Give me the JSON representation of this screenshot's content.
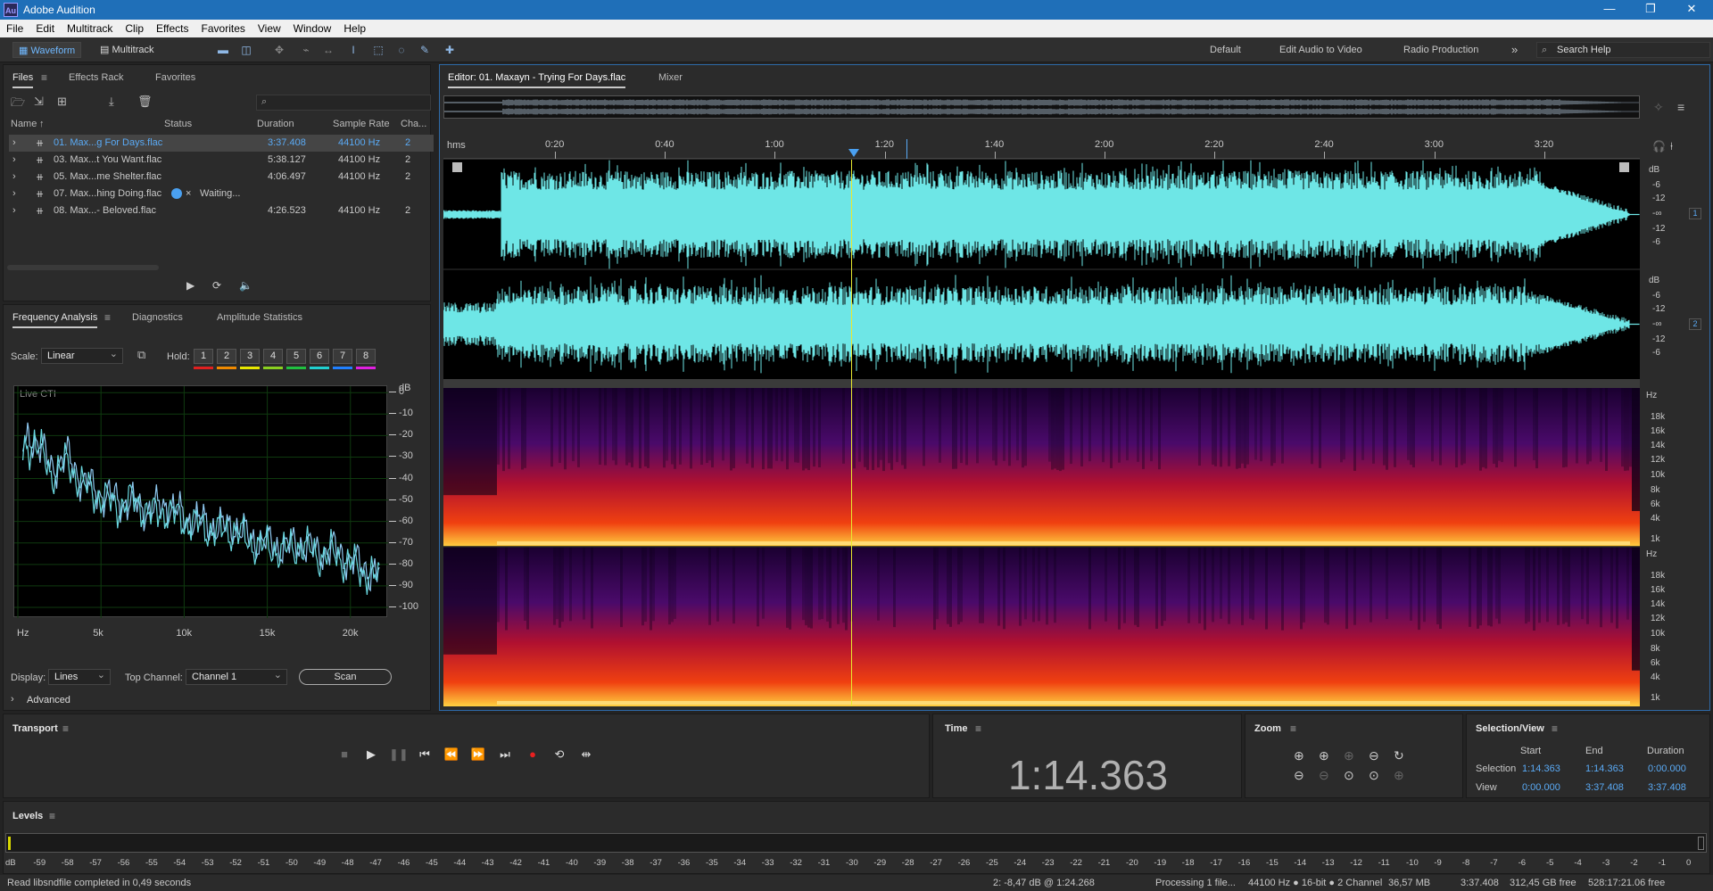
{
  "app": {
    "title": "Adobe Audition",
    "logo": "Au"
  },
  "menu": [
    "File",
    "Edit",
    "Multitrack",
    "Clip",
    "Effects",
    "Favorites",
    "View",
    "Window",
    "Help"
  ],
  "toolbar": {
    "waveform": "Waveform",
    "multitrack": "Multitrack",
    "workspaces": [
      "Default",
      "Edit Audio to Video",
      "Radio Production"
    ],
    "search_placeholder": "Search Help"
  },
  "files_panel": {
    "tabs": [
      "Files",
      "Effects Rack",
      "Favorites"
    ],
    "columns": [
      "Name",
      "Status",
      "Duration",
      "Sample Rate",
      "Cha..."
    ],
    "rows": [
      {
        "name": "01. Max...g For Days.flac",
        "status": "",
        "duration": "3:37.408",
        "rate": "44100 Hz",
        "ch": "2"
      },
      {
        "name": "03. Max...t You Want.flac",
        "status": "",
        "duration": "5:38.127",
        "rate": "44100 Hz",
        "ch": "2"
      },
      {
        "name": "05. Max...me Shelter.flac",
        "status": "",
        "duration": "4:06.497",
        "rate": "44100 Hz",
        "ch": "2"
      },
      {
        "name": "07. Max...hing Doing.flac",
        "status": "Waiting...",
        "duration": "",
        "rate": "",
        "ch": ""
      },
      {
        "name": "08. Max...- Beloved.flac",
        "status": "",
        "duration": "4:26.523",
        "rate": "44100 Hz",
        "ch": "2"
      }
    ]
  },
  "analysis_panel": {
    "tabs": [
      "Frequency Analysis",
      "Diagnostics",
      "Amplitude Statistics"
    ],
    "scale_label": "Scale:",
    "scale_value": "Linear",
    "hold_label": "Hold:",
    "holds": [
      "1",
      "2",
      "3",
      "4",
      "5",
      "6",
      "7",
      "8"
    ],
    "hold_colors": [
      "#e02020",
      "#f08a00",
      "#e8e800",
      "#8ad020",
      "#20c040",
      "#20d0d0",
      "#2080ff",
      "#e020e0"
    ],
    "live_label": "Live CTI",
    "display_label": "Display:",
    "display_value": "Lines",
    "top_channel_label": "Top Channel:",
    "top_channel_value": "Channel 1",
    "scan": "Scan",
    "advanced": "Advanced"
  },
  "chart_data": {
    "type": "line",
    "title": "",
    "xlabel": "",
    "ylabel": "dB",
    "x_unit_label": "Hz",
    "xlim": [
      0,
      22050
    ],
    "ylim": [
      -105,
      3
    ],
    "x_ticks": [
      "Hz",
      "5k",
      "10k",
      "15k",
      "20k"
    ],
    "x_tick_values": [
      0,
      5000,
      10000,
      15000,
      20000
    ],
    "y_ticks": [
      "dB",
      "0",
      "-10",
      "-20",
      "-30",
      "-40",
      "-50",
      "-60",
      "-70",
      "-80",
      "-90",
      "-100"
    ],
    "y_tick_values": [
      null,
      0,
      -10,
      -20,
      -30,
      -40,
      -50,
      -60,
      -70,
      -80,
      -90,
      -100
    ],
    "series": [
      {
        "color": "#8ec8f0",
        "x": [
          300,
          1000,
          2000,
          3000,
          4000,
          5000,
          6000,
          7000,
          8000,
          9000,
          10000,
          11000,
          12000,
          13000,
          14000,
          15000,
          16000,
          17000,
          18000,
          19000,
          20000,
          21000,
          21800
        ],
        "values": [
          -25,
          -20,
          -35,
          -30,
          -42,
          -47,
          -50,
          -52,
          -55,
          -52,
          -58,
          -60,
          -63,
          -62,
          -68,
          -70,
          -72,
          -70,
          -74,
          -73,
          -78,
          -82,
          -85
        ]
      },
      {
        "color": "#6ad8e0",
        "x": [
          300,
          1000,
          2000,
          3000,
          4000,
          5000,
          6000,
          7000,
          8000,
          9000,
          10000,
          11000,
          12000,
          13000,
          14000,
          15000,
          16000,
          17000,
          18000,
          19000,
          20000,
          21000,
          21800
        ],
        "values": [
          -28,
          -22,
          -38,
          -33,
          -44,
          -49,
          -53,
          -50,
          -57,
          -55,
          -60,
          -62,
          -65,
          -64,
          -70,
          -72,
          -74,
          -71,
          -76,
          -75,
          -80,
          -84,
          -88
        ]
      }
    ]
  },
  "editor": {
    "tab": "Editor: 01. Maxayn - Trying For Days.flac",
    "mixer_tab": "Mixer",
    "ruler_unit": "hms",
    "ruler_ticks": [
      "0:20",
      "0:40",
      "1:00",
      "1:20",
      "1:40",
      "2:00",
      "2:20",
      "2:40",
      "3:00",
      "3:20"
    ],
    "db_labels": [
      "dB",
      "-6",
      "-12",
      "-∞",
      "-12",
      "-6"
    ],
    "hz_labels": [
      "Hz",
      "18k",
      "16k",
      "14k",
      "12k",
      "10k",
      "8k",
      "6k",
      "4k",
      "1k"
    ],
    "channel_badges": [
      "1",
      "2"
    ],
    "colors": {
      "waveform": "#6ee6e6",
      "playhead": "#e8e830",
      "background": "#000000"
    }
  },
  "transport": {
    "title": "Transport"
  },
  "time_panel": {
    "title": "Time",
    "value": "1:14.363"
  },
  "zoom_panel": {
    "title": "Zoom"
  },
  "selection_view": {
    "title": "Selection/View",
    "headers": [
      "Start",
      "End",
      "Duration"
    ],
    "rows": [
      {
        "label": "Selection",
        "start": "1:14.363",
        "end": "1:14.363",
        "duration": "0:00.000"
      },
      {
        "label": "View",
        "start": "0:00.000",
        "end": "3:37.408",
        "duration": "3:37.408"
      }
    ]
  },
  "levels": {
    "title": "Levels",
    "ticks": [
      "dB",
      "-59",
      "-58",
      "-57",
      "-56",
      "-55",
      "-54",
      "-53",
      "-52",
      "-51",
      "-50",
      "-49",
      "-48",
      "-47",
      "-46",
      "-45",
      "-44",
      "-43",
      "-42",
      "-41",
      "-40",
      "-39",
      "-38",
      "-37",
      "-36",
      "-35",
      "-34",
      "-33",
      "-32",
      "-31",
      "-30",
      "-29",
      "-28",
      "-27",
      "-26",
      "-25",
      "-24",
      "-23",
      "-22",
      "-21",
      "-20",
      "-19",
      "-18",
      "-17",
      "-16",
      "-15",
      "-14",
      "-13",
      "-12",
      "-11",
      "-10",
      "-9",
      "-8",
      "-7",
      "-6",
      "-5",
      "-4",
      "-3",
      "-2",
      "-1",
      "0"
    ]
  },
  "status": {
    "left": "Read libsndfile completed in 0,49 seconds",
    "cursor": "2: -8,47 dB @ 1:24.268",
    "processing": "Processing 1 file...",
    "format": "44100 Hz ● 16-bit ● 2 Channel",
    "size": "36,57 MB",
    "duration": "3:37.408",
    "free": "312,45 GB free",
    "free_time": "528:17:21.06 free"
  }
}
